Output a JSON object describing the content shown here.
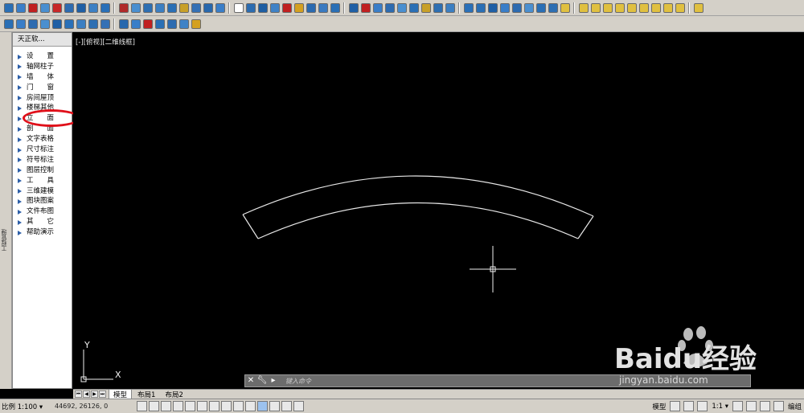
{
  "toolbar1": {
    "icons": [
      "#2a6fb5",
      "#3a7ec8",
      "#c02020",
      "#4a8fd0",
      "#c82828",
      "#2d6bb0",
      "#1f5fa5",
      "#3d80c4",
      "#2a70b8",
      "#b02a2a",
      "#4a8fd0",
      "#2e6fb2",
      "#3c7fc2",
      "#2a6fb5",
      "#c8a028",
      "#3470b5",
      "#2868ad",
      "#3a7ec8",
      "#ffffff",
      "#2c6cb0",
      "#1e5ea2",
      "#3f82c6",
      "#c02020",
      "#d4a020",
      "#2a6ab0",
      "#3a7ac0",
      "#2a6fb5",
      "#1f5fa5",
      "#c02020",
      "#3a7ec8",
      "#2d6bb0",
      "#4a8fd0",
      "#2a6fb5",
      "#c8a028",
      "#2e6fb2",
      "#3c7fc2",
      "#2a70b8",
      "#2a6fb5",
      "#1f5fa5",
      "#3a7ec8",
      "#2d6bb0",
      "#4a8fd0",
      "#2a6fb5",
      "#2e6fb2",
      "#e0c040",
      "#e0c040",
      "#e0c040",
      "#e0c040",
      "#e0c040",
      "#e0c040",
      "#e0c040",
      "#e0c040",
      "#e0c040",
      "#e0c040",
      "#e0c040"
    ]
  },
  "toolbar2": {
    "icons": [
      "#2a6fb5",
      "#3a7ec8",
      "#2d6bb0",
      "#4a8fd0",
      "#1f5fa5",
      "#2a70b8",
      "#3c7fc2",
      "#2e6fb2",
      "#3470b5",
      "#2868ad",
      "#3a7ec8",
      "#c02020",
      "#2a6fb5",
      "#2d6bb0",
      "#3f82c6",
      "#d4a020"
    ]
  },
  "panel": {
    "title": "天正软...",
    "items": [
      "设　　置",
      "轴网柱子",
      "墙　　体",
      "门　　窗",
      "房间屋顶",
      "楼梯其他",
      "立　　面",
      "剖　　面",
      "文字表格",
      "尺寸标注",
      "符号标注",
      "图层控制",
      "工　　具",
      "三维建模",
      "图块图案",
      "文件布图",
      "其　　它",
      "帮助演示"
    ],
    "highlighted_item": "门　　窗",
    "highlight_color": "#e0101a"
  },
  "side_strip": {
    "label": "工程管理"
  },
  "viewport": {
    "label": "[-][俯视][二维线框]",
    "ucs_y": "Y",
    "ucs_x": "X"
  },
  "command": {
    "placeholder": "键入命令"
  },
  "layout_tabs": [
    "模型",
    "布局1",
    "布局2"
  ],
  "status": {
    "scale": "比例 1:100 ▾",
    "coords": "44692,  26126,  0",
    "model_label": "模型",
    "annotation_scale": "1:1 ▾",
    "edit_label": "编组"
  },
  "watermark": {
    "brand": "Baidu经验",
    "url": "jingyan.baidu.com"
  }
}
